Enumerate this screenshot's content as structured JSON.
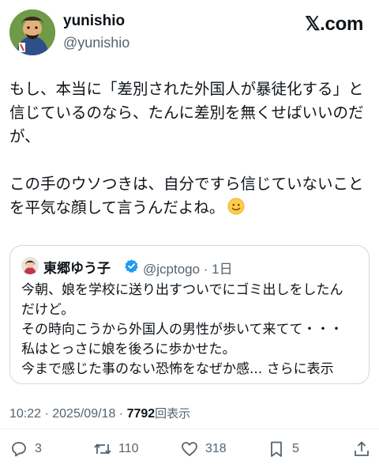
{
  "header": {
    "display_name": "yunishio",
    "handle": "@yunishio",
    "brand": "𝕏.com"
  },
  "post": {
    "text": "もし、本当に「差別された外国人が暴徒化する」と\n信じているのなら、たんに差別を無くせばいいのだ\nが、\n\nこの手のウソつきは、自分ですら信じていないこと\nを平気な顔して言うんだよね。",
    "emoji": "slightly-smiling-face-icon"
  },
  "quote": {
    "name": "東郷ゆう子",
    "handle": "@jcptogo · 1日",
    "text": "今朝、娘を学校に送り出すついでにゴミ出しをしたん\nだけど。\nその時向こうから外国人の男性が歩いて来てて・・・\n私はとっさに娘を後ろに歩かせた。\n今まで感じた事のない恐怖をなぜか感... さらに表示"
  },
  "meta": {
    "timestamp": "10:22 · 2025/09/18 · ",
    "views": "7792",
    "views_label": "回表示"
  },
  "actions": {
    "replies": "3",
    "reposts": "110",
    "likes": "318",
    "bookmarks": "5"
  },
  "colors": {
    "text": "#0f1419",
    "secondary": "#536471",
    "border": "#cfd9de",
    "verified": "#1d9bf0"
  }
}
